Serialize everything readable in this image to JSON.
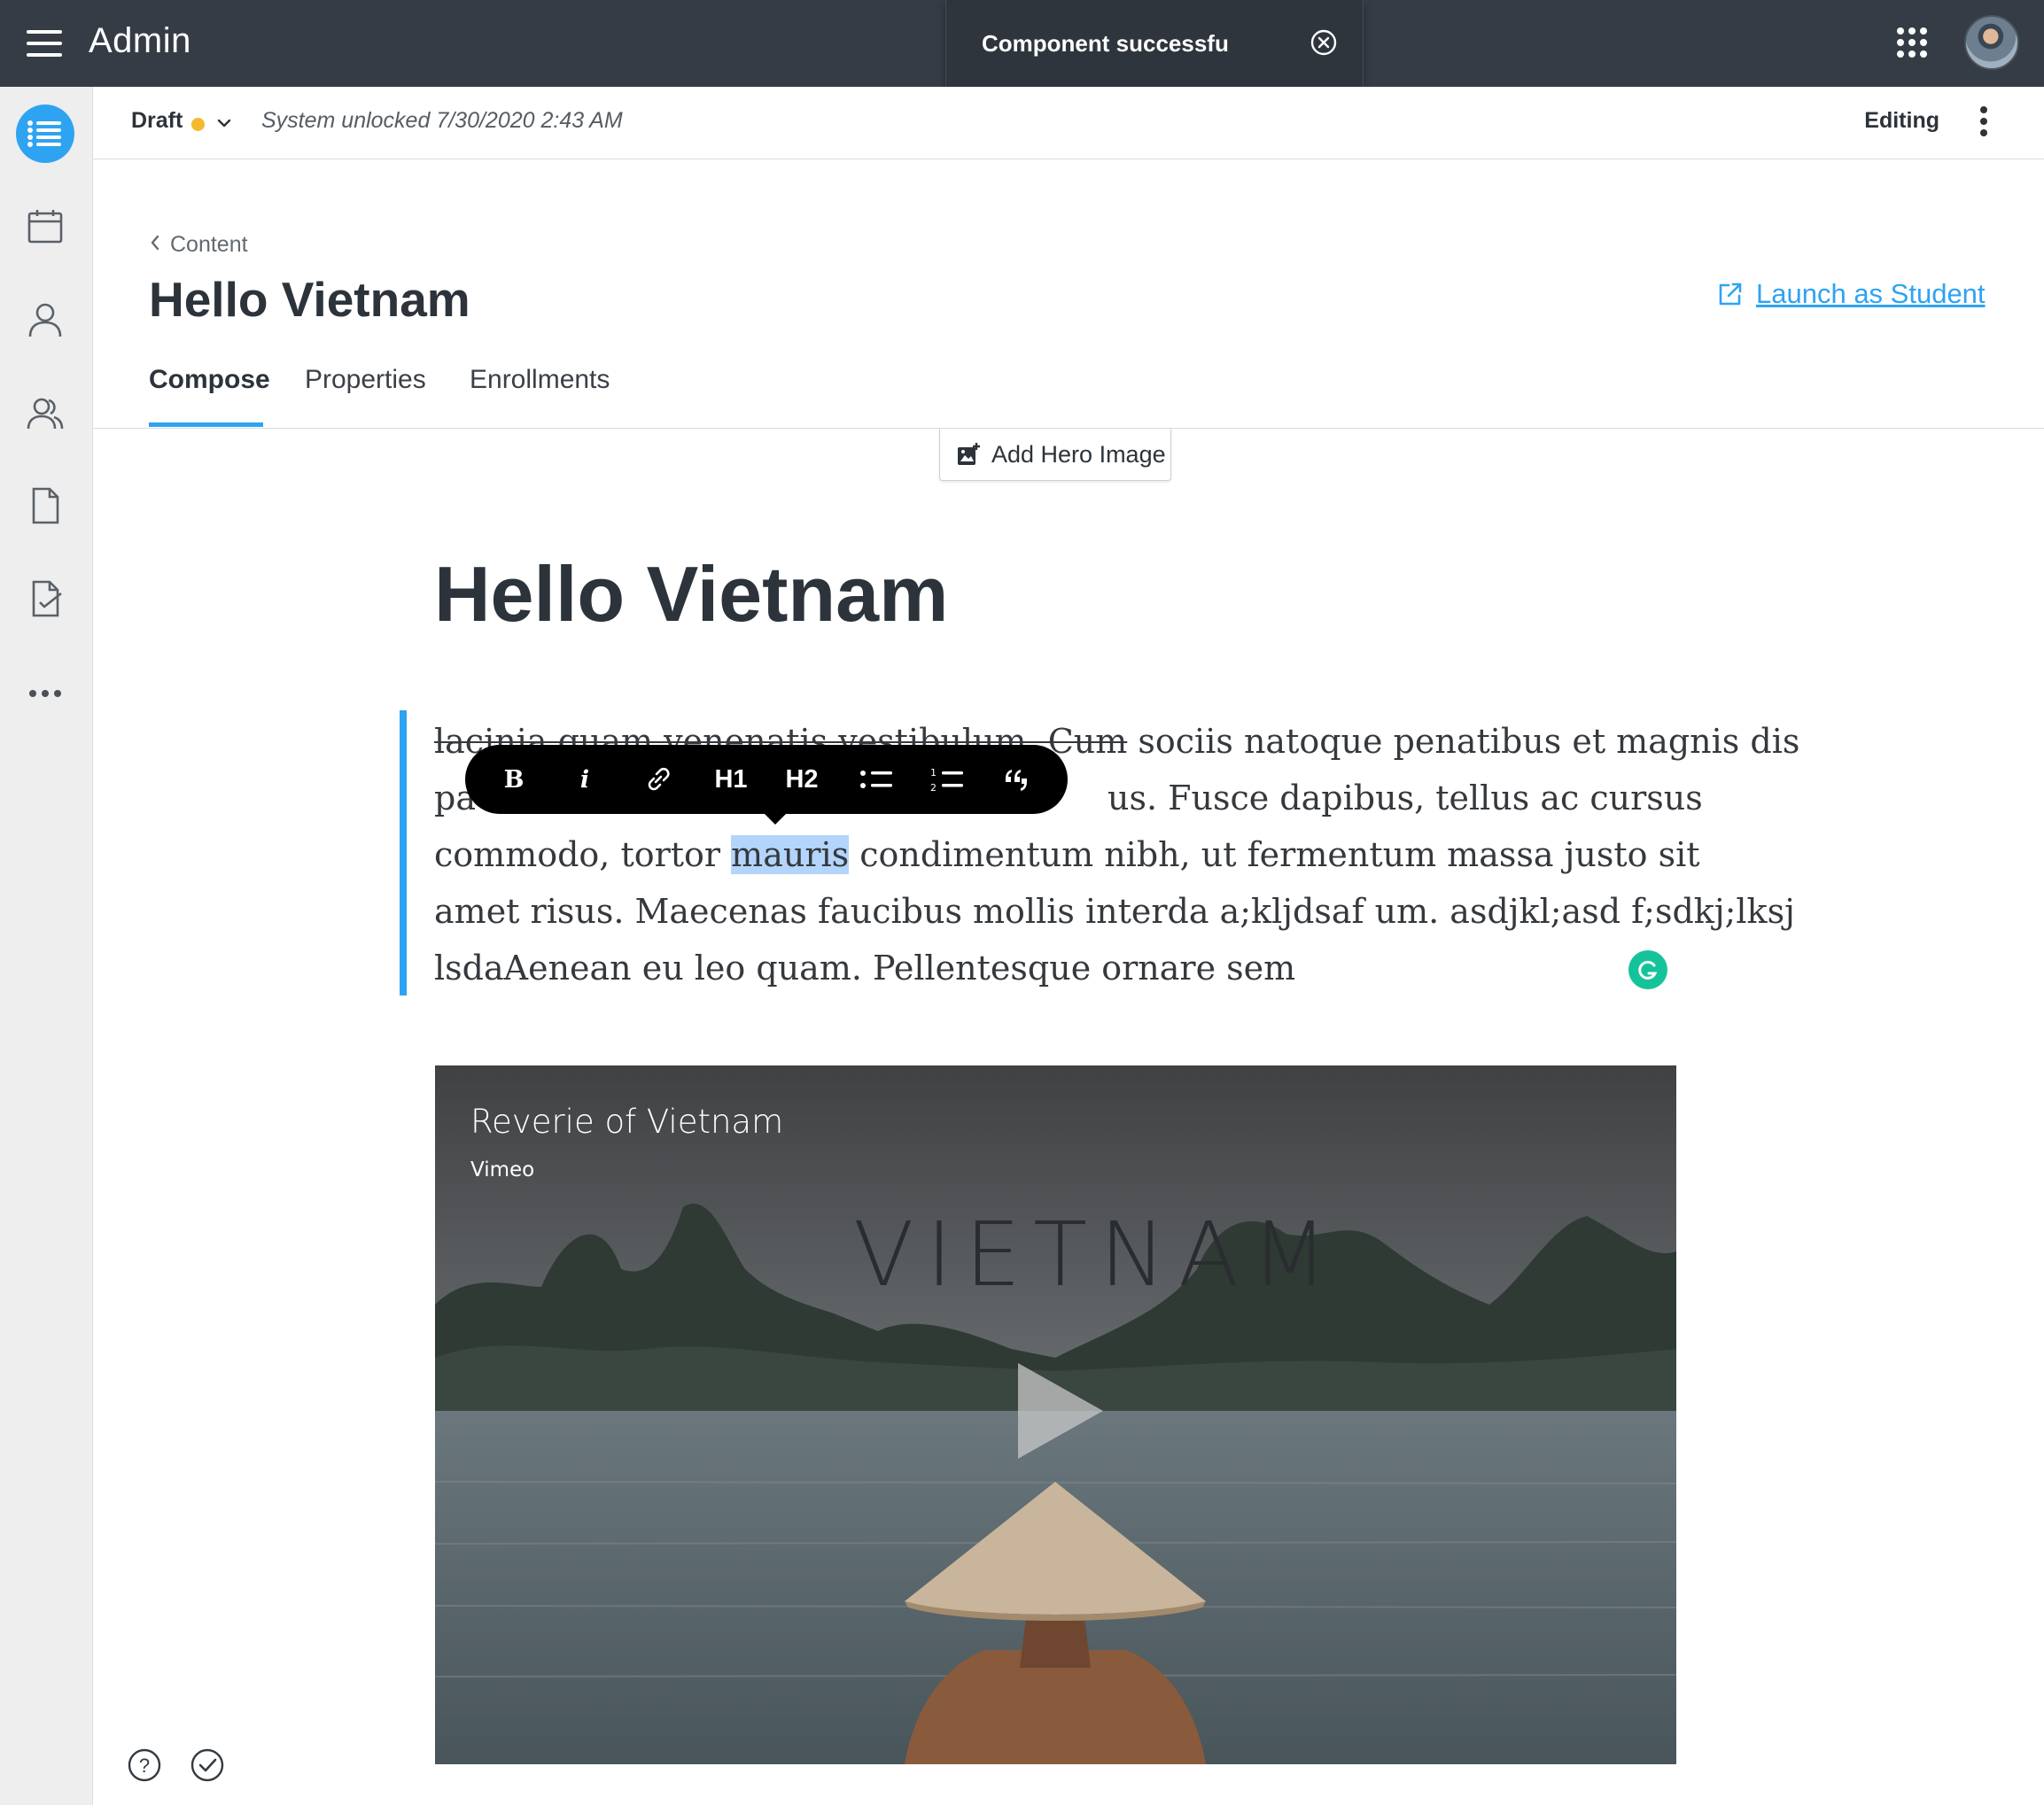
{
  "header": {
    "app_title": "Admin",
    "toast_message": "Component successfu"
  },
  "statusbar": {
    "draft_label": "Draft",
    "system_unlocked": "System unlocked 7/30/2020 2:43 AM",
    "mode_label": "Editing",
    "draft_dot_color": "#f5b92d"
  },
  "page": {
    "breadcrumb": "Content",
    "title": "Hello Vietnam",
    "launch_label": "Launch as Student",
    "tabs": [
      {
        "label": "Compose",
        "active": true
      },
      {
        "label": "Properties",
        "active": false
      },
      {
        "label": "Enrollments",
        "active": false
      }
    ],
    "hero_button": "Add Hero Image"
  },
  "editor": {
    "doc_title": "Hello Vietnam",
    "paragraph": {
      "line1_a": "lacinia quam venenatis vestibulum. Cum",
      "line1_b": " sociis natoque penatibus et magnis dis",
      "line2_a": "pa",
      "line2_b": "us. Fusce dapibus, tellus ac cursus",
      "line3_a": "commodo, tortor ",
      "line3_sel": "mauris",
      "line3_b": " condimentum nibh, ut fermentum massa justo sit",
      "line4": "amet risus. Maecenas faucibus mollis interda a;kljdsaf um. asdjkl;asd f;sdkj;lksj",
      "line5": "lsdaAenean eu leo quam. Pellentesque ornare sem"
    },
    "toolbar": {
      "bold": "B",
      "italic": "i",
      "h1": "H1",
      "h2": "H2"
    }
  },
  "video": {
    "title": "Reverie of Vietnam",
    "source": "Vimeo",
    "overlay_word": "VIETNAM"
  },
  "icons": {
    "accent": "#2ea3f2",
    "rail": [
      "list-icon",
      "calendar-icon",
      "user-icon",
      "users-icon",
      "document-icon",
      "checklist-icon",
      "more-icon"
    ],
    "grammarly": "#15c39a"
  }
}
